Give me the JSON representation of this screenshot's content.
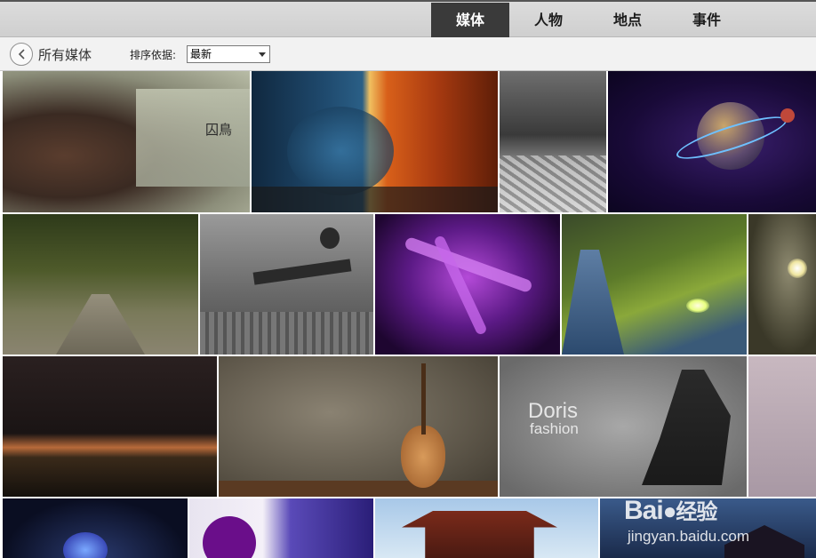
{
  "tabs": [
    {
      "label": "媒体",
      "active": true
    },
    {
      "label": "人物",
      "active": false
    },
    {
      "label": "地点",
      "active": false
    },
    {
      "label": "事件",
      "active": false
    }
  ],
  "toolbar": {
    "breadcrumb": "所有媒体",
    "sort_label": "排序依据:",
    "sort_value": "最新"
  },
  "thumbnails": {
    "t1_caption": "囚鳥",
    "t12_caption": "Doris",
    "t12_subcaption": "fashion"
  },
  "watermark": {
    "brand": "Bai",
    "brand_suffix": "经验",
    "url": "jingyan.baidu.com"
  },
  "colors": {
    "active_tab": "#3a3a3a",
    "tab_bar": "#d6d6d6",
    "toolbar": "#f2f2f2"
  }
}
